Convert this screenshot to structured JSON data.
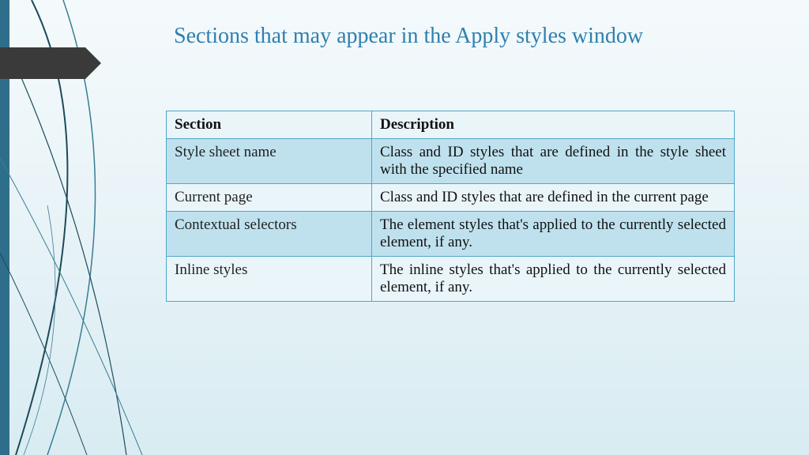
{
  "title": "Sections that may appear in the Apply styles window",
  "table": {
    "headers": {
      "section": "Section",
      "description": "Description"
    },
    "rows": [
      {
        "section": "Style sheet name",
        "description": "Class and ID styles that are defined in the style sheet with the specified name"
      },
      {
        "section": "Current page",
        "description": "Class and ID styles that are defined in the current page"
      },
      {
        "section": "Contextual selectors",
        "description": "The element styles that's applied to the currently selected element, if any."
      },
      {
        "section": "Inline styles",
        "description": "The inline styles that's applied to the currently selected element, if any."
      }
    ]
  }
}
